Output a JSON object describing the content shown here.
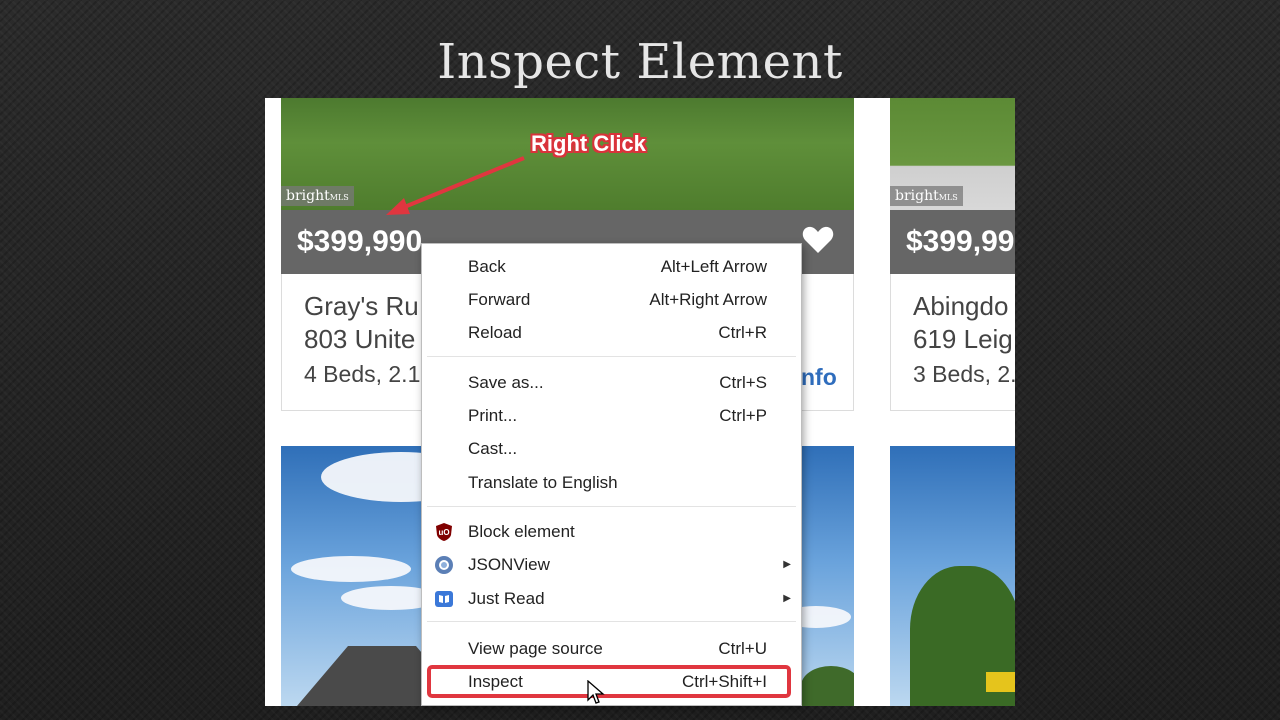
{
  "slide": {
    "title": "Inspect Element"
  },
  "annotation": {
    "label": "Right Click"
  },
  "listings": [
    {
      "watermark": "bright",
      "watermark_small": "MLS",
      "price": "$399,990",
      "name": "Gray's Ru",
      "address": "803 Unite",
      "beds": "4 Beds, 2.1",
      "more": "nfo"
    },
    {
      "watermark": "bright",
      "watermark_small": "MLS",
      "price": "$399,99",
      "name": "Abingdo",
      "address": "619 Leig",
      "beds": "3 Beds, 2."
    }
  ],
  "context_menu": {
    "items": [
      {
        "label": "Back",
        "shortcut": "Alt+Left Arrow"
      },
      {
        "label": "Forward",
        "shortcut": "Alt+Right Arrow"
      },
      {
        "label": "Reload",
        "shortcut": "Ctrl+R"
      },
      {
        "label": "Save as...",
        "shortcut": "Ctrl+S"
      },
      {
        "label": "Print...",
        "shortcut": "Ctrl+P"
      },
      {
        "label": "Cast..."
      },
      {
        "label": "Translate to English"
      },
      {
        "label": "Block element",
        "icon": "ublock-icon"
      },
      {
        "label": "JSONView",
        "icon": "jsonview-icon"
      },
      {
        "label": "Just Read",
        "icon": "just-read-icon"
      },
      {
        "label": "View page source",
        "shortcut": "Ctrl+U"
      },
      {
        "label": "Inspect",
        "shortcut": "Ctrl+Shift+I"
      }
    ]
  },
  "colors": {
    "highlight": "#e0363f",
    "price_bar": "#666666",
    "link": "#2f6dbd"
  }
}
